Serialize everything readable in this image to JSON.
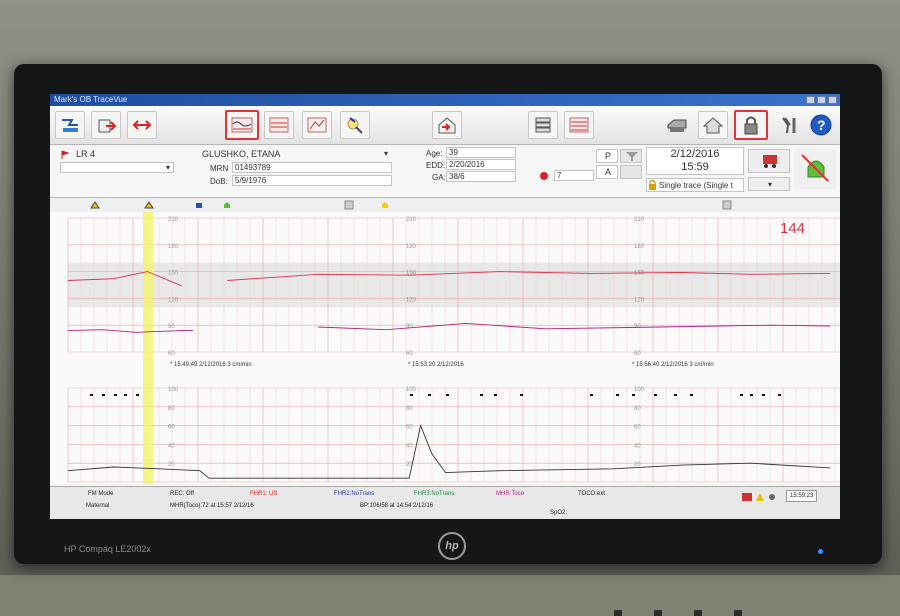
{
  "window": {
    "title": "Mark's OB TraceVue"
  },
  "toolbar": {
    "buttons": [
      {
        "icon": "patient-list-icon"
      },
      {
        "icon": "transfer-icon"
      },
      {
        "icon": "swap-icon"
      },
      {
        "icon": "trace-view-icon",
        "selected": true
      },
      {
        "icon": "overview-icon"
      },
      {
        "icon": "zoom-trace-icon"
      },
      {
        "icon": "search-icon"
      },
      {
        "icon": "admit-icon"
      },
      {
        "icon": "stack-icon"
      },
      {
        "icon": "multi-trace-icon"
      },
      {
        "icon": "printer-icon"
      },
      {
        "icon": "home-icon"
      },
      {
        "icon": "lock-icon",
        "selected": true
      },
      {
        "icon": "tools-icon"
      },
      {
        "icon": "help-icon"
      }
    ]
  },
  "patient": {
    "bed": "LR 4",
    "name": "GLUSHKO, ETANA",
    "mrn_label": "MRN",
    "mrn": "01493789",
    "dob_label": "DoB:",
    "dob": "5/9/1976",
    "age_label": "Age:",
    "age": "39",
    "edd_label": "EDD:",
    "edd": "2/20/2016",
    "ga_label": "GA:",
    "ga": "38/6",
    "alert_count": "7",
    "p_label": "P",
    "a_label": "A"
  },
  "datetime": {
    "date": "2/12/2016",
    "time": "15:59"
  },
  "trace_mode": "Single trace (Single t",
  "chart": {
    "fhr_value": "144",
    "scale_labels_upper": [
      "210",
      "180",
      "150",
      "120",
      "90",
      "60"
    ],
    "scale_labels_lower": [
      "100",
      "80",
      "60",
      "40",
      "20"
    ],
    "markers": [
      "* 15:49:49 2/12/2016  3 cm/min",
      "* 15:53:20 2/12/2016",
      "* 15:56:40 2/12/2016  3 cm/min"
    ],
    "colors": {
      "fhr": "#d9304a",
      "grid_major": "#e8a7a7",
      "grid_minor": "#f3d3d3",
      "band": "#d8d8d8",
      "toco": "#333333",
      "highlight": "#f3f36a"
    }
  },
  "chart_data": {
    "type": "line",
    "series": [
      {
        "values": [
          [
            0,
            140
          ],
          [
            20,
            142
          ],
          [
            35,
            150
          ],
          [
            50,
            134
          ],
          [
            70,
            140
          ],
          [
            110,
            147
          ],
          [
            150,
            146
          ],
          [
            190,
            150
          ],
          [
            230,
            148
          ],
          [
            270,
            149
          ],
          [
            300,
            147
          ],
          [
            335,
            148
          ]
        ]
      },
      {
        "values": [
          [
            0,
            84
          ],
          [
            15,
            85
          ],
          [
            30,
            82
          ],
          [
            50,
            84
          ],
          [
            55,
            84
          ],
          [
            110,
            88
          ],
          [
            140,
            85
          ],
          [
            175,
            92
          ],
          [
            210,
            86
          ],
          [
            260,
            88
          ],
          [
            310,
            90
          ],
          [
            335,
            89
          ]
        ]
      },
      {
        "values": [
          [
            0,
            12
          ],
          [
            20,
            16
          ],
          [
            40,
            14
          ],
          [
            58,
            12
          ],
          [
            62,
            4
          ],
          [
            100,
            4
          ],
          [
            150,
            4
          ],
          [
            155,
            60
          ],
          [
            160,
            30
          ],
          [
            166,
            10
          ],
          [
            190,
            12
          ],
          [
            240,
            14
          ],
          [
            270,
            18
          ],
          [
            300,
            20
          ],
          [
            335,
            15
          ]
        ]
      }
    ]
  },
  "statusbar": {
    "fm_mode": "FM Mode",
    "rec": "REC: Off",
    "fhr1": "FHR1: US",
    "fhr2": "FHR2:NoTrans",
    "fhr3": "FHR3:NoTrans",
    "mhr": "MHR:Toco",
    "toco": "TOCO:ext",
    "maternal": "Maternal",
    "mhr_toco": "MHR(Toco):72 at 15:57 2/12/16",
    "bp": "BP:106/58 at 14:54 2/12/16",
    "spo2": "SpO2:",
    "clock": "15:59:23"
  },
  "monitor": {
    "brand": "hp",
    "model": "HP Compaq LE2002x"
  }
}
